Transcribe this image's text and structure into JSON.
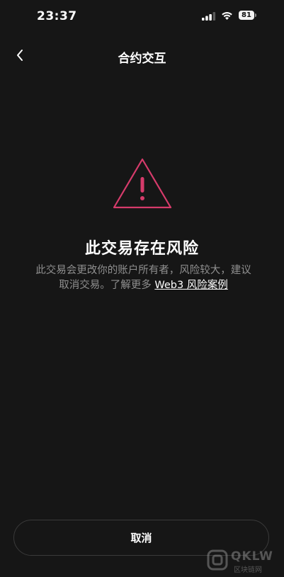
{
  "status_bar": {
    "time": "23:37",
    "battery_level": "81",
    "signal_icon": "cellular-signal-icon",
    "wifi_icon": "wifi-icon"
  },
  "nav": {
    "title": "合约交互",
    "back_icon": "chevron-left-icon"
  },
  "warning": {
    "icon": "warning-triangle-icon",
    "icon_color": "#d63b6b",
    "title": "此交易存在风险",
    "description_line1": "此交易会更改你的账户所有者，风险较大，建议",
    "description_line2": "取消交易。了解更多",
    "link_text": "Web3 风险案例"
  },
  "actions": {
    "cancel_label": "取消"
  },
  "watermark": {
    "brand": "QKLW",
    "sub": "区块链网"
  },
  "colors": {
    "background": "#161616",
    "text_primary": "#ffffff",
    "text_secondary": "#8f8f8f",
    "accent_warning": "#d63b6b"
  }
}
